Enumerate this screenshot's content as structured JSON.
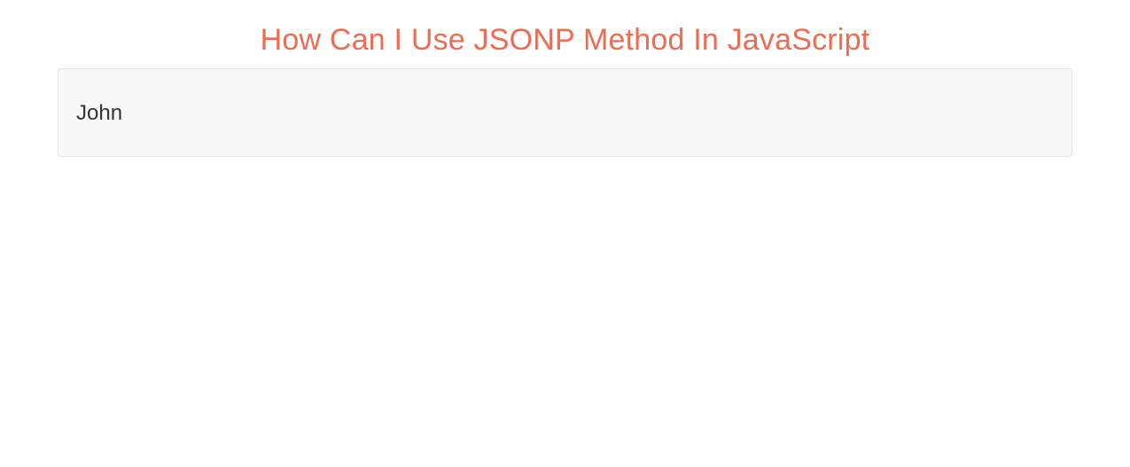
{
  "page": {
    "title": "How Can I Use JSONP Method In JavaScript"
  },
  "well": {
    "content": "John"
  }
}
